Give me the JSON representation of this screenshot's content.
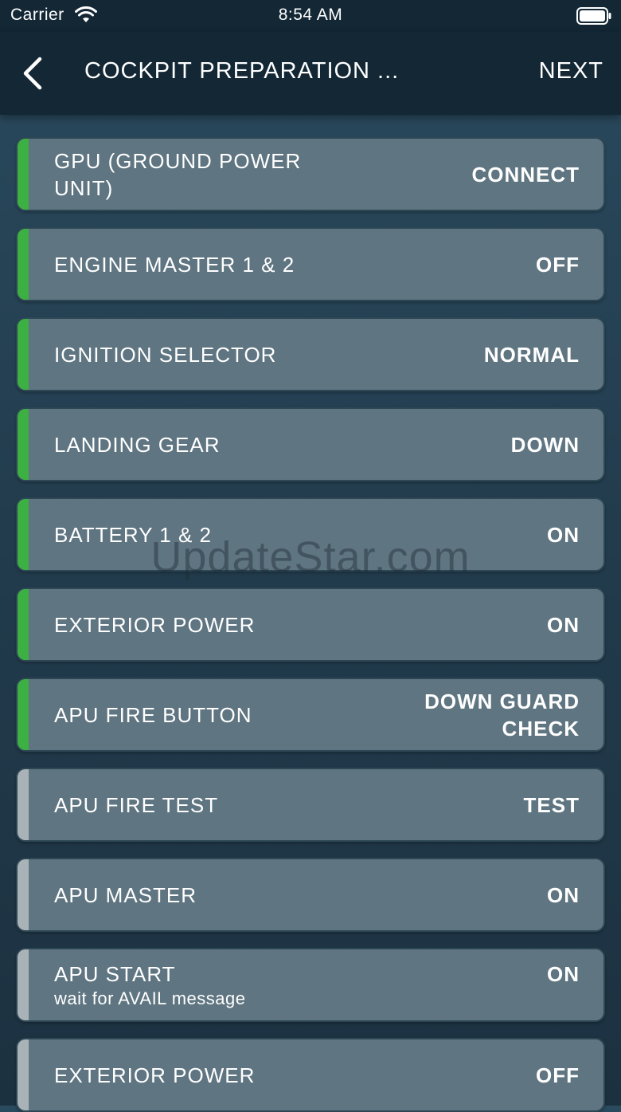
{
  "status_bar": {
    "carrier": "Carrier",
    "time": "8:54 AM"
  },
  "nav": {
    "title": "COCKPIT PREPARATION ...",
    "next_label": "NEXT"
  },
  "items": [
    {
      "label": "GPU (GROUND POWER UNIT)",
      "sub": "",
      "value": "CONNECT",
      "status": "done"
    },
    {
      "label": "ENGINE MASTER 1 & 2",
      "sub": "",
      "value": "OFF",
      "status": "done"
    },
    {
      "label": "IGNITION SELECTOR",
      "sub": "",
      "value": "NORMAL",
      "status": "done"
    },
    {
      "label": "LANDING GEAR",
      "sub": "",
      "value": "DOWN",
      "status": "done"
    },
    {
      "label": "BATTERY 1 & 2",
      "sub": "",
      "value": "ON",
      "status": "done"
    },
    {
      "label": "EXTERIOR POWER",
      "sub": "",
      "value": "ON",
      "status": "done"
    },
    {
      "label": "APU FIRE BUTTON",
      "sub": "",
      "value": "DOWN GUARD CHECK",
      "status": "done"
    },
    {
      "label": "APU FIRE TEST",
      "sub": "",
      "value": "TEST",
      "status": "pending"
    },
    {
      "label": "APU MASTER",
      "sub": "",
      "value": "ON",
      "status": "pending"
    },
    {
      "label": "APU START",
      "sub": "wait for AVAIL message",
      "value": "ON",
      "status": "pending"
    },
    {
      "label": "EXTERIOR POWER",
      "sub": "",
      "value": "OFF",
      "status": "pending"
    }
  ],
  "watermark": "UpdateStar.com",
  "colors": {
    "done": "#3cb043",
    "pending": "#a9b2b7",
    "card": "#5f7581",
    "nav": "#132735"
  }
}
